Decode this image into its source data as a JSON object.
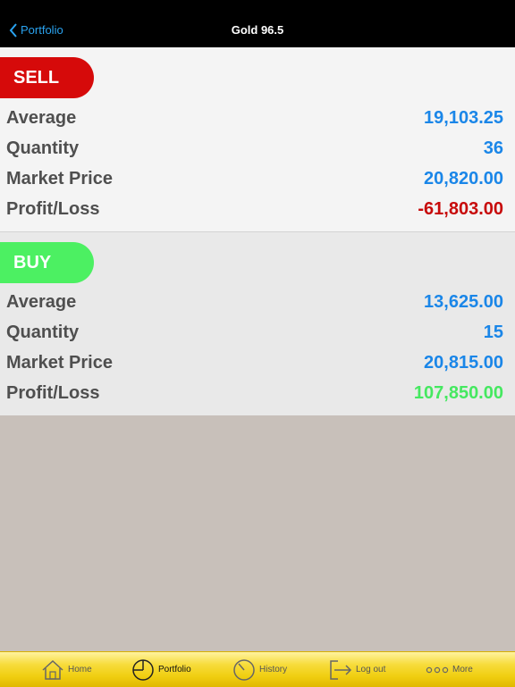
{
  "nav": {
    "back_label": "Portfolio",
    "title": "Gold 96.5"
  },
  "sell": {
    "label": "SELL",
    "rows": [
      {
        "label": "Average",
        "value": "19,103.25"
      },
      {
        "label": "Quantity",
        "value": "36"
      },
      {
        "label": "Market Price",
        "value": "20,820.00"
      },
      {
        "label": "Profit/Loss",
        "value": "-61,803.00"
      }
    ]
  },
  "buy": {
    "label": "BUY",
    "rows": [
      {
        "label": "Average",
        "value": "13,625.00"
      },
      {
        "label": "Quantity",
        "value": "15"
      },
      {
        "label": "Market Price",
        "value": "20,815.00"
      },
      {
        "label": "Profit/Loss",
        "value": "107,850.00"
      }
    ]
  },
  "tabs": [
    {
      "label": "Home",
      "icon": "home-icon"
    },
    {
      "label": "Portfolio",
      "icon": "pie-chart-icon",
      "active": true
    },
    {
      "label": "History",
      "icon": "clock-icon"
    },
    {
      "label": "Log out",
      "icon": "logout-icon"
    },
    {
      "label": "More",
      "icon": "more-icon"
    }
  ],
  "colors": {
    "sell": "#d60a0a",
    "buy": "#4cf062",
    "value_blue": "#1a86e8",
    "loss": "#c70a0a",
    "profit": "#45e860",
    "accent": "#2aa3f0"
  }
}
